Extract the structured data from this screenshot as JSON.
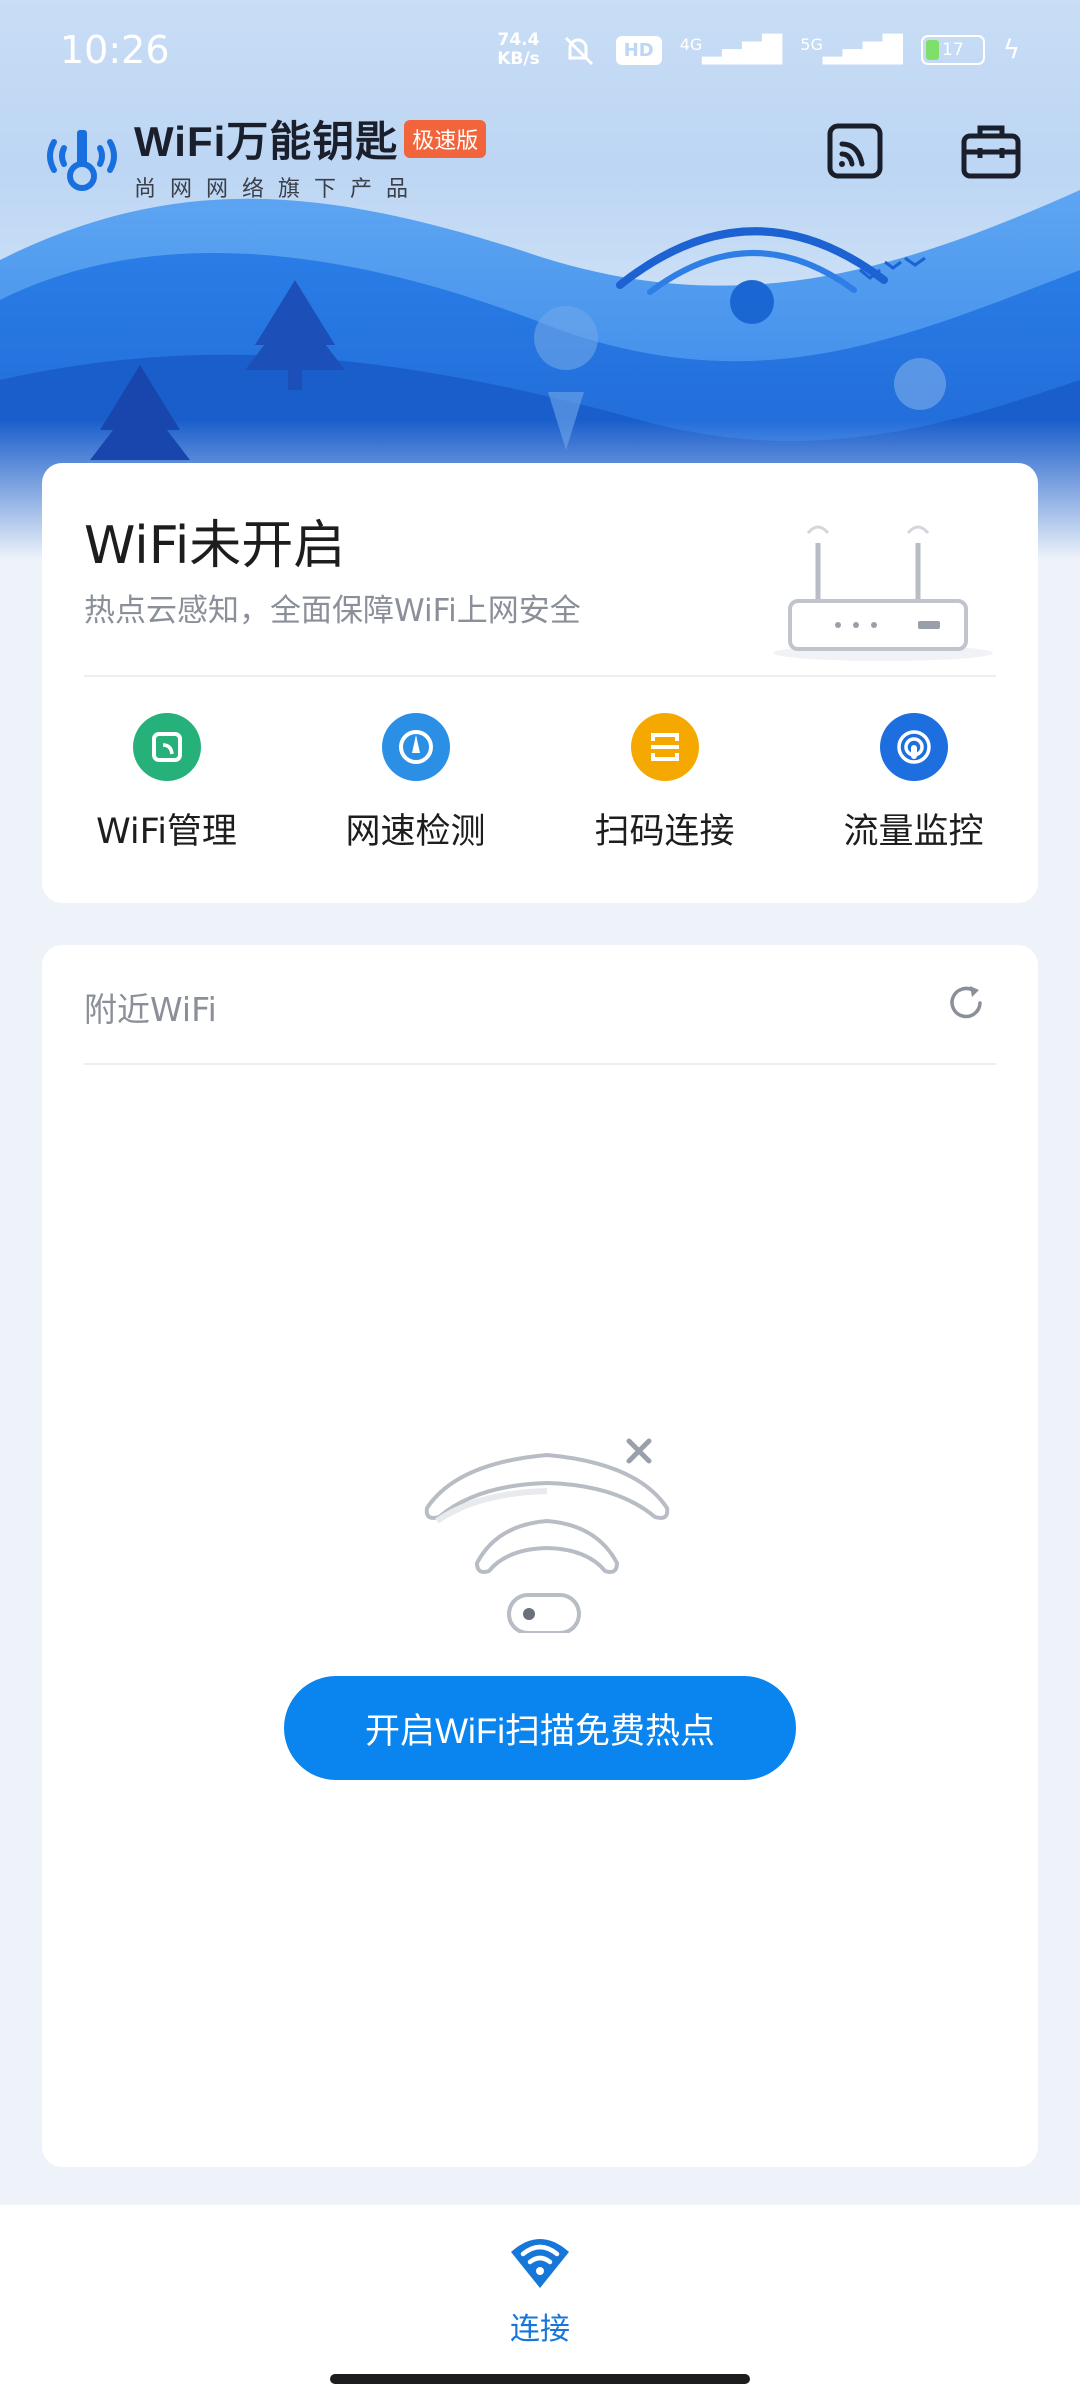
{
  "status_bar": {
    "time": "10:26",
    "net_speed_value": "74.4",
    "net_speed_unit": "KB/s",
    "hd_label": "HD",
    "network_1": "4G",
    "network_2": "5G",
    "battery_level": "17"
  },
  "header": {
    "app_name": "WiFi万能钥匙",
    "edition_badge": "极速版",
    "subtitle": "尚网网络旗下产品"
  },
  "status_card": {
    "title": "WiFi未开启",
    "subtitle": "热点云感知，全面保障WiFi上网安全",
    "tools": [
      {
        "label": "WiFi管理",
        "icon": "wifi-manage-icon",
        "color": "#26b07a"
      },
      {
        "label": "网速检测",
        "icon": "speed-test-icon",
        "color": "#2b8fe6"
      },
      {
        "label": "扫码连接",
        "icon": "scan-connect-icon",
        "color": "#f5a800"
      },
      {
        "label": "流量监控",
        "icon": "traffic-monitor-icon",
        "color": "#1d6fe0"
      }
    ]
  },
  "nearby": {
    "title": "附近WiFi",
    "action_button": "开启WiFi扫描免费热点"
  },
  "bottom_nav": {
    "items": [
      {
        "label": "连接",
        "icon": "wifi-connect-icon",
        "active": true
      }
    ]
  },
  "colors": {
    "accent": "#0a84ee",
    "brand_badge": "#f2653c",
    "hero_wave_dark": "#1f6fdb",
    "hero_wave_light": "#3f8ff0"
  }
}
